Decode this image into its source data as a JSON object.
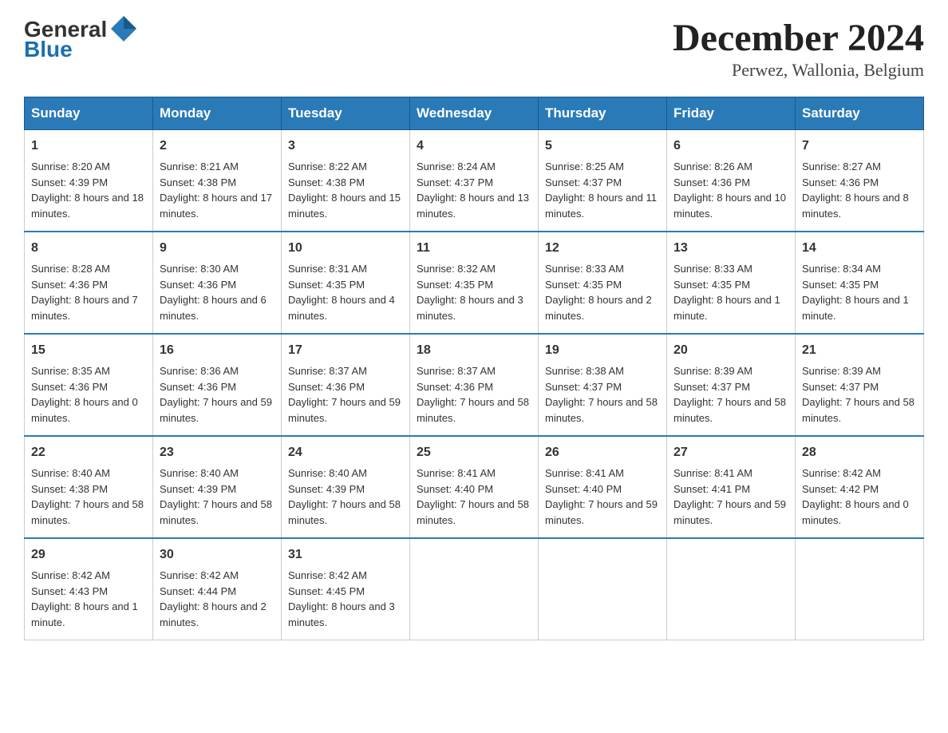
{
  "header": {
    "logo_text_general": "General",
    "logo_text_blue": "Blue",
    "title": "December 2024",
    "subtitle": "Perwez, Wallonia, Belgium"
  },
  "days_of_week": [
    "Sunday",
    "Monday",
    "Tuesday",
    "Wednesday",
    "Thursday",
    "Friday",
    "Saturday"
  ],
  "weeks": [
    [
      {
        "day": "1",
        "sunrise": "8:20 AM",
        "sunset": "4:39 PM",
        "daylight": "8 hours and 18 minutes."
      },
      {
        "day": "2",
        "sunrise": "8:21 AM",
        "sunset": "4:38 PM",
        "daylight": "8 hours and 17 minutes."
      },
      {
        "day": "3",
        "sunrise": "8:22 AM",
        "sunset": "4:38 PM",
        "daylight": "8 hours and 15 minutes."
      },
      {
        "day": "4",
        "sunrise": "8:24 AM",
        "sunset": "4:37 PM",
        "daylight": "8 hours and 13 minutes."
      },
      {
        "day": "5",
        "sunrise": "8:25 AM",
        "sunset": "4:37 PM",
        "daylight": "8 hours and 11 minutes."
      },
      {
        "day": "6",
        "sunrise": "8:26 AM",
        "sunset": "4:36 PM",
        "daylight": "8 hours and 10 minutes."
      },
      {
        "day": "7",
        "sunrise": "8:27 AM",
        "sunset": "4:36 PM",
        "daylight": "8 hours and 8 minutes."
      }
    ],
    [
      {
        "day": "8",
        "sunrise": "8:28 AM",
        "sunset": "4:36 PM",
        "daylight": "8 hours and 7 minutes."
      },
      {
        "day": "9",
        "sunrise": "8:30 AM",
        "sunset": "4:36 PM",
        "daylight": "8 hours and 6 minutes."
      },
      {
        "day": "10",
        "sunrise": "8:31 AM",
        "sunset": "4:35 PM",
        "daylight": "8 hours and 4 minutes."
      },
      {
        "day": "11",
        "sunrise": "8:32 AM",
        "sunset": "4:35 PM",
        "daylight": "8 hours and 3 minutes."
      },
      {
        "day": "12",
        "sunrise": "8:33 AM",
        "sunset": "4:35 PM",
        "daylight": "8 hours and 2 minutes."
      },
      {
        "day": "13",
        "sunrise": "8:33 AM",
        "sunset": "4:35 PM",
        "daylight": "8 hours and 1 minute."
      },
      {
        "day": "14",
        "sunrise": "8:34 AM",
        "sunset": "4:35 PM",
        "daylight": "8 hours and 1 minute."
      }
    ],
    [
      {
        "day": "15",
        "sunrise": "8:35 AM",
        "sunset": "4:36 PM",
        "daylight": "8 hours and 0 minutes."
      },
      {
        "day": "16",
        "sunrise": "8:36 AM",
        "sunset": "4:36 PM",
        "daylight": "7 hours and 59 minutes."
      },
      {
        "day": "17",
        "sunrise": "8:37 AM",
        "sunset": "4:36 PM",
        "daylight": "7 hours and 59 minutes."
      },
      {
        "day": "18",
        "sunrise": "8:37 AM",
        "sunset": "4:36 PM",
        "daylight": "7 hours and 58 minutes."
      },
      {
        "day": "19",
        "sunrise": "8:38 AM",
        "sunset": "4:37 PM",
        "daylight": "7 hours and 58 minutes."
      },
      {
        "day": "20",
        "sunrise": "8:39 AM",
        "sunset": "4:37 PM",
        "daylight": "7 hours and 58 minutes."
      },
      {
        "day": "21",
        "sunrise": "8:39 AM",
        "sunset": "4:37 PM",
        "daylight": "7 hours and 58 minutes."
      }
    ],
    [
      {
        "day": "22",
        "sunrise": "8:40 AM",
        "sunset": "4:38 PM",
        "daylight": "7 hours and 58 minutes."
      },
      {
        "day": "23",
        "sunrise": "8:40 AM",
        "sunset": "4:39 PM",
        "daylight": "7 hours and 58 minutes."
      },
      {
        "day": "24",
        "sunrise": "8:40 AM",
        "sunset": "4:39 PM",
        "daylight": "7 hours and 58 minutes."
      },
      {
        "day": "25",
        "sunrise": "8:41 AM",
        "sunset": "4:40 PM",
        "daylight": "7 hours and 58 minutes."
      },
      {
        "day": "26",
        "sunrise": "8:41 AM",
        "sunset": "4:40 PM",
        "daylight": "7 hours and 59 minutes."
      },
      {
        "day": "27",
        "sunrise": "8:41 AM",
        "sunset": "4:41 PM",
        "daylight": "7 hours and 59 minutes."
      },
      {
        "day": "28",
        "sunrise": "8:42 AM",
        "sunset": "4:42 PM",
        "daylight": "8 hours and 0 minutes."
      }
    ],
    [
      {
        "day": "29",
        "sunrise": "8:42 AM",
        "sunset": "4:43 PM",
        "daylight": "8 hours and 1 minute."
      },
      {
        "day": "30",
        "sunrise": "8:42 AM",
        "sunset": "4:44 PM",
        "daylight": "8 hours and 2 minutes."
      },
      {
        "day": "31",
        "sunrise": "8:42 AM",
        "sunset": "4:45 PM",
        "daylight": "8 hours and 3 minutes."
      },
      null,
      null,
      null,
      null
    ]
  ]
}
